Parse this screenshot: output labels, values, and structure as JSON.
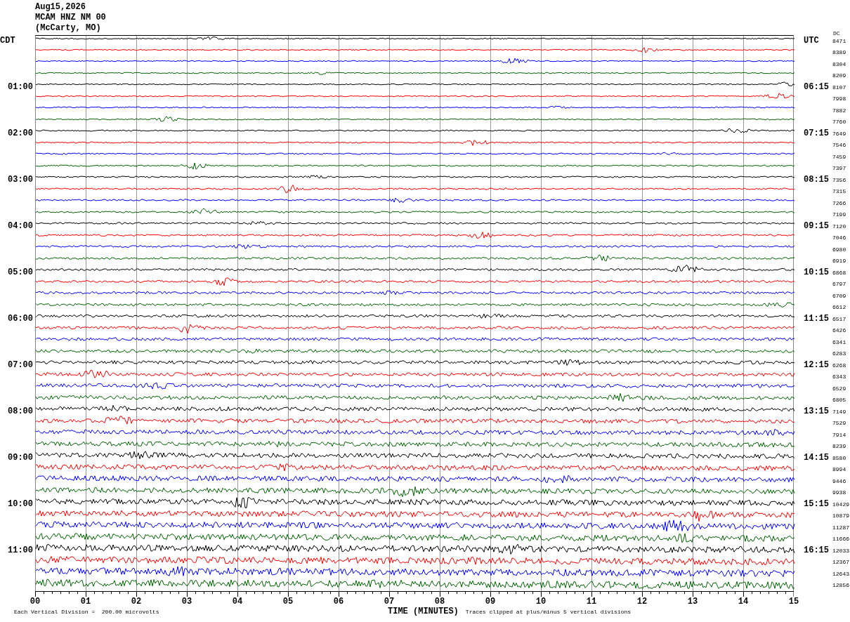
{
  "header": {
    "date": "Aug15,2026",
    "station": "MCAM HNZ NM 00",
    "location": "(McCarty, MO)"
  },
  "left_zone": "CDT",
  "right_zone": "UTC",
  "dc_header": "DC",
  "rows": [
    {
      "color": "#000000",
      "dc": "8471"
    },
    {
      "color": "#ff0000",
      "dc": "8389"
    },
    {
      "color": "#0000ff",
      "dc": "8304"
    },
    {
      "color": "#006400",
      "dc": "8209"
    },
    {
      "color": "#000000",
      "dc": "8107",
      "cdt": "01:00",
      "utc": "06:15"
    },
    {
      "color": "#ff0000",
      "dc": "7998"
    },
    {
      "color": "#0000ff",
      "dc": "7882"
    },
    {
      "color": "#006400",
      "dc": "7760"
    },
    {
      "color": "#000000",
      "dc": "7649",
      "cdt": "02:00",
      "utc": "07:15"
    },
    {
      "color": "#ff0000",
      "dc": "7546"
    },
    {
      "color": "#0000ff",
      "dc": "7459"
    },
    {
      "color": "#006400",
      "dc": "7397"
    },
    {
      "color": "#000000",
      "dc": "7356",
      "cdt": "03:00",
      "utc": "08:15"
    },
    {
      "color": "#ff0000",
      "dc": "7315"
    },
    {
      "color": "#0000ff",
      "dc": "7266"
    },
    {
      "color": "#006400",
      "dc": "7199"
    },
    {
      "color": "#000000",
      "dc": "7120",
      "cdt": "04:00",
      "utc": "09:15"
    },
    {
      "color": "#ff0000",
      "dc": "7046"
    },
    {
      "color": "#0000ff",
      "dc": "6980"
    },
    {
      "color": "#006400",
      "dc": "6919"
    },
    {
      "color": "#000000",
      "dc": "6868",
      "cdt": "05:00",
      "utc": "10:15"
    },
    {
      "color": "#ff0000",
      "dc": "6797"
    },
    {
      "color": "#0000ff",
      "dc": "6709"
    },
    {
      "color": "#006400",
      "dc": "6612"
    },
    {
      "color": "#000000",
      "dc": "6517",
      "cdt": "06:00",
      "utc": "11:15"
    },
    {
      "color": "#ff0000",
      "dc": "6426"
    },
    {
      "color": "#0000ff",
      "dc": "6341"
    },
    {
      "color": "#006400",
      "dc": "6283"
    },
    {
      "color": "#000000",
      "dc": "6268",
      "cdt": "07:00",
      "utc": "12:15"
    },
    {
      "color": "#ff0000",
      "dc": "6343"
    },
    {
      "color": "#0000ff",
      "dc": "6529"
    },
    {
      "color": "#006400",
      "dc": "6805"
    },
    {
      "color": "#000000",
      "dc": "7149",
      "cdt": "08:00",
      "utc": "13:15"
    },
    {
      "color": "#ff0000",
      "dc": "7529"
    },
    {
      "color": "#0000ff",
      "dc": "7914"
    },
    {
      "color": "#006400",
      "dc": "8239"
    },
    {
      "color": "#000000",
      "dc": "8580",
      "cdt": "09:00",
      "utc": "14:15"
    },
    {
      "color": "#ff0000",
      "dc": "8994"
    },
    {
      "color": "#0000ff",
      "dc": "9446"
    },
    {
      "color": "#006400",
      "dc": "9938"
    },
    {
      "color": "#000000",
      "dc": "10429",
      "cdt": "10:00",
      "utc": "15:15"
    },
    {
      "color": "#ff0000",
      "dc": "10879"
    },
    {
      "color": "#0000ff",
      "dc": "11287"
    },
    {
      "color": "#006400",
      "dc": "11666"
    },
    {
      "color": "#000000",
      "dc": "12033",
      "cdt": "11:00",
      "utc": "16:15"
    },
    {
      "color": "#ff0000",
      "dc": "12367"
    },
    {
      "color": "#0000ff",
      "dc": "12643"
    },
    {
      "color": "#006400",
      "dc": "12856"
    }
  ],
  "x_axis": {
    "ticks": [
      "00",
      "01",
      "02",
      "03",
      "04",
      "05",
      "06",
      "07",
      "08",
      "09",
      "10",
      "11",
      "12",
      "13",
      "14",
      "15"
    ],
    "title": "TIME (MINUTES)"
  },
  "footer": {
    "scale": "Each Vertical Division =  200.00 microvolts",
    "clip": "Traces clipped at plus/minus 5 vertical divisions"
  }
}
